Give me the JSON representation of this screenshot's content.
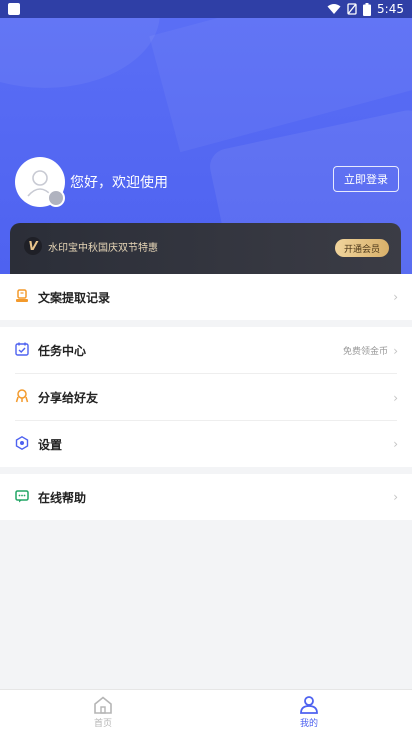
{
  "status": {
    "time": "5:45"
  },
  "hero": {
    "greeting": "您好，欢迎使用",
    "login_label": "立即登录"
  },
  "vip": {
    "badge": "V",
    "text": "水印宝中秋国庆双节特惠",
    "button": "开通会员"
  },
  "menu": [
    {
      "label": "文案提取记录",
      "icon": "document-stamp-icon"
    },
    {
      "label": "任务中心",
      "extra": "免费领金币",
      "icon": "checklist-icon"
    },
    {
      "label": "分享给好友",
      "icon": "share-icon"
    },
    {
      "label": "设置",
      "icon": "settings-hex-icon"
    },
    {
      "label": "在线帮助",
      "icon": "chat-help-icon"
    }
  ],
  "tabs": [
    {
      "label": "首页",
      "icon": "home-icon"
    },
    {
      "label": "我的",
      "icon": "profile-icon"
    }
  ],
  "colors": {
    "primary": "#4e62f0",
    "gold": "#e8c48b"
  }
}
